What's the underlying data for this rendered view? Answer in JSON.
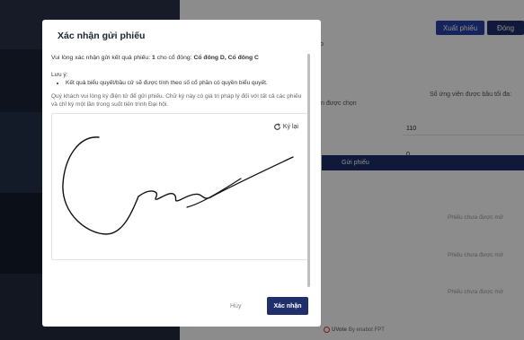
{
  "background": {
    "export_button": "Xuất phiếu",
    "close_button": "Đóng",
    "text_fragment_o": "o",
    "max_votes_label": "Số ứng viên được bầu tối đa:",
    "selected_text": "n được chọn",
    "field_value_110": "110",
    "field_value_0": "0",
    "submit_bar_label": "Gửi phiếu",
    "status_texts": [
      "Phiếu chưa được mở",
      "Phiếu chưa được mở",
      "Phiếu chưa được mở"
    ],
    "brand_name": "UVote",
    "brand_suffix": "By enabot FPT"
  },
  "modal": {
    "title": "Xác nhận gửi phiếu",
    "intro_prefix": "Vui lòng xác nhận gửi kết quả phiếu: ",
    "intro_count": "1",
    "intro_middle": " cho cổ đông: ",
    "intro_shareholders": "Cổ đông D, Cổ đông C",
    "note_label": "Lưu ý:",
    "note_item": "Kết quả biểu quyết/bầu cử sẽ được tính theo số cổ phần có quyền biểu quyết.",
    "instruction": "Quý khách vui lòng ký điện tử để gửi phiếu. Chữ ký này có giá trị pháp lý đối với tất cả các phiếu và chỉ ký một lần trong suốt tiến trình Đại hội.",
    "redo_label": "Ký lại",
    "cancel_label": "Hủy",
    "confirm_label": "Xác nhận"
  }
}
